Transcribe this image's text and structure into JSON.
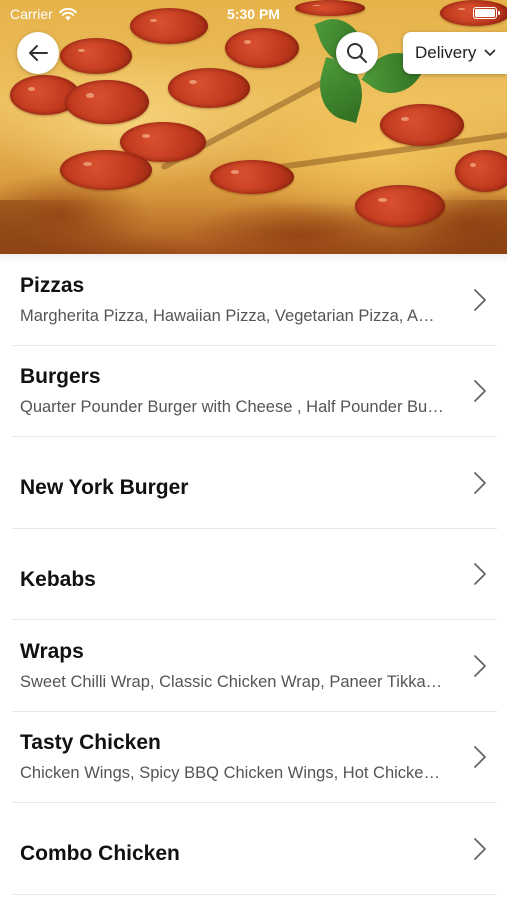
{
  "status_bar": {
    "carrier": "Carrier",
    "time": "5:30 PM",
    "icons": [
      "wifi-icon",
      "battery-icon"
    ]
  },
  "header": {
    "back_icon": "arrow-left-icon",
    "search_icon": "search-icon",
    "delivery_label": "Delivery",
    "delivery_icon": "chevron-down-icon"
  },
  "categories": [
    {
      "title": "Pizzas",
      "subtitle": "Margherita Pizza, Hawaiian Pizza, Vegetarian Pizza, American Hot Pizza"
    },
    {
      "title": "Burgers",
      "subtitle": "Quarter Pounder Burger with Cheese , Half Pounder Burger with Cheese"
    },
    {
      "title": "New York Burger",
      "subtitle": ""
    },
    {
      "title": "Kebabs",
      "subtitle": ""
    },
    {
      "title": "Wraps",
      "subtitle": "Sweet Chilli Wrap, Classic Chicken Wrap, Paneer Tikka Wrap"
    },
    {
      "title": "Tasty Chicken",
      "subtitle": "Chicken Wings, Spicy BBQ Chicken Wings, Hot Chicken Wings"
    },
    {
      "title": "Combo Chicken",
      "subtitle": ""
    }
  ],
  "colors": {
    "background": "#ffffff",
    "title_text": "#111111",
    "subtitle_text": "#555555",
    "divider": "#e6e6e6",
    "chevron": "#666666"
  }
}
